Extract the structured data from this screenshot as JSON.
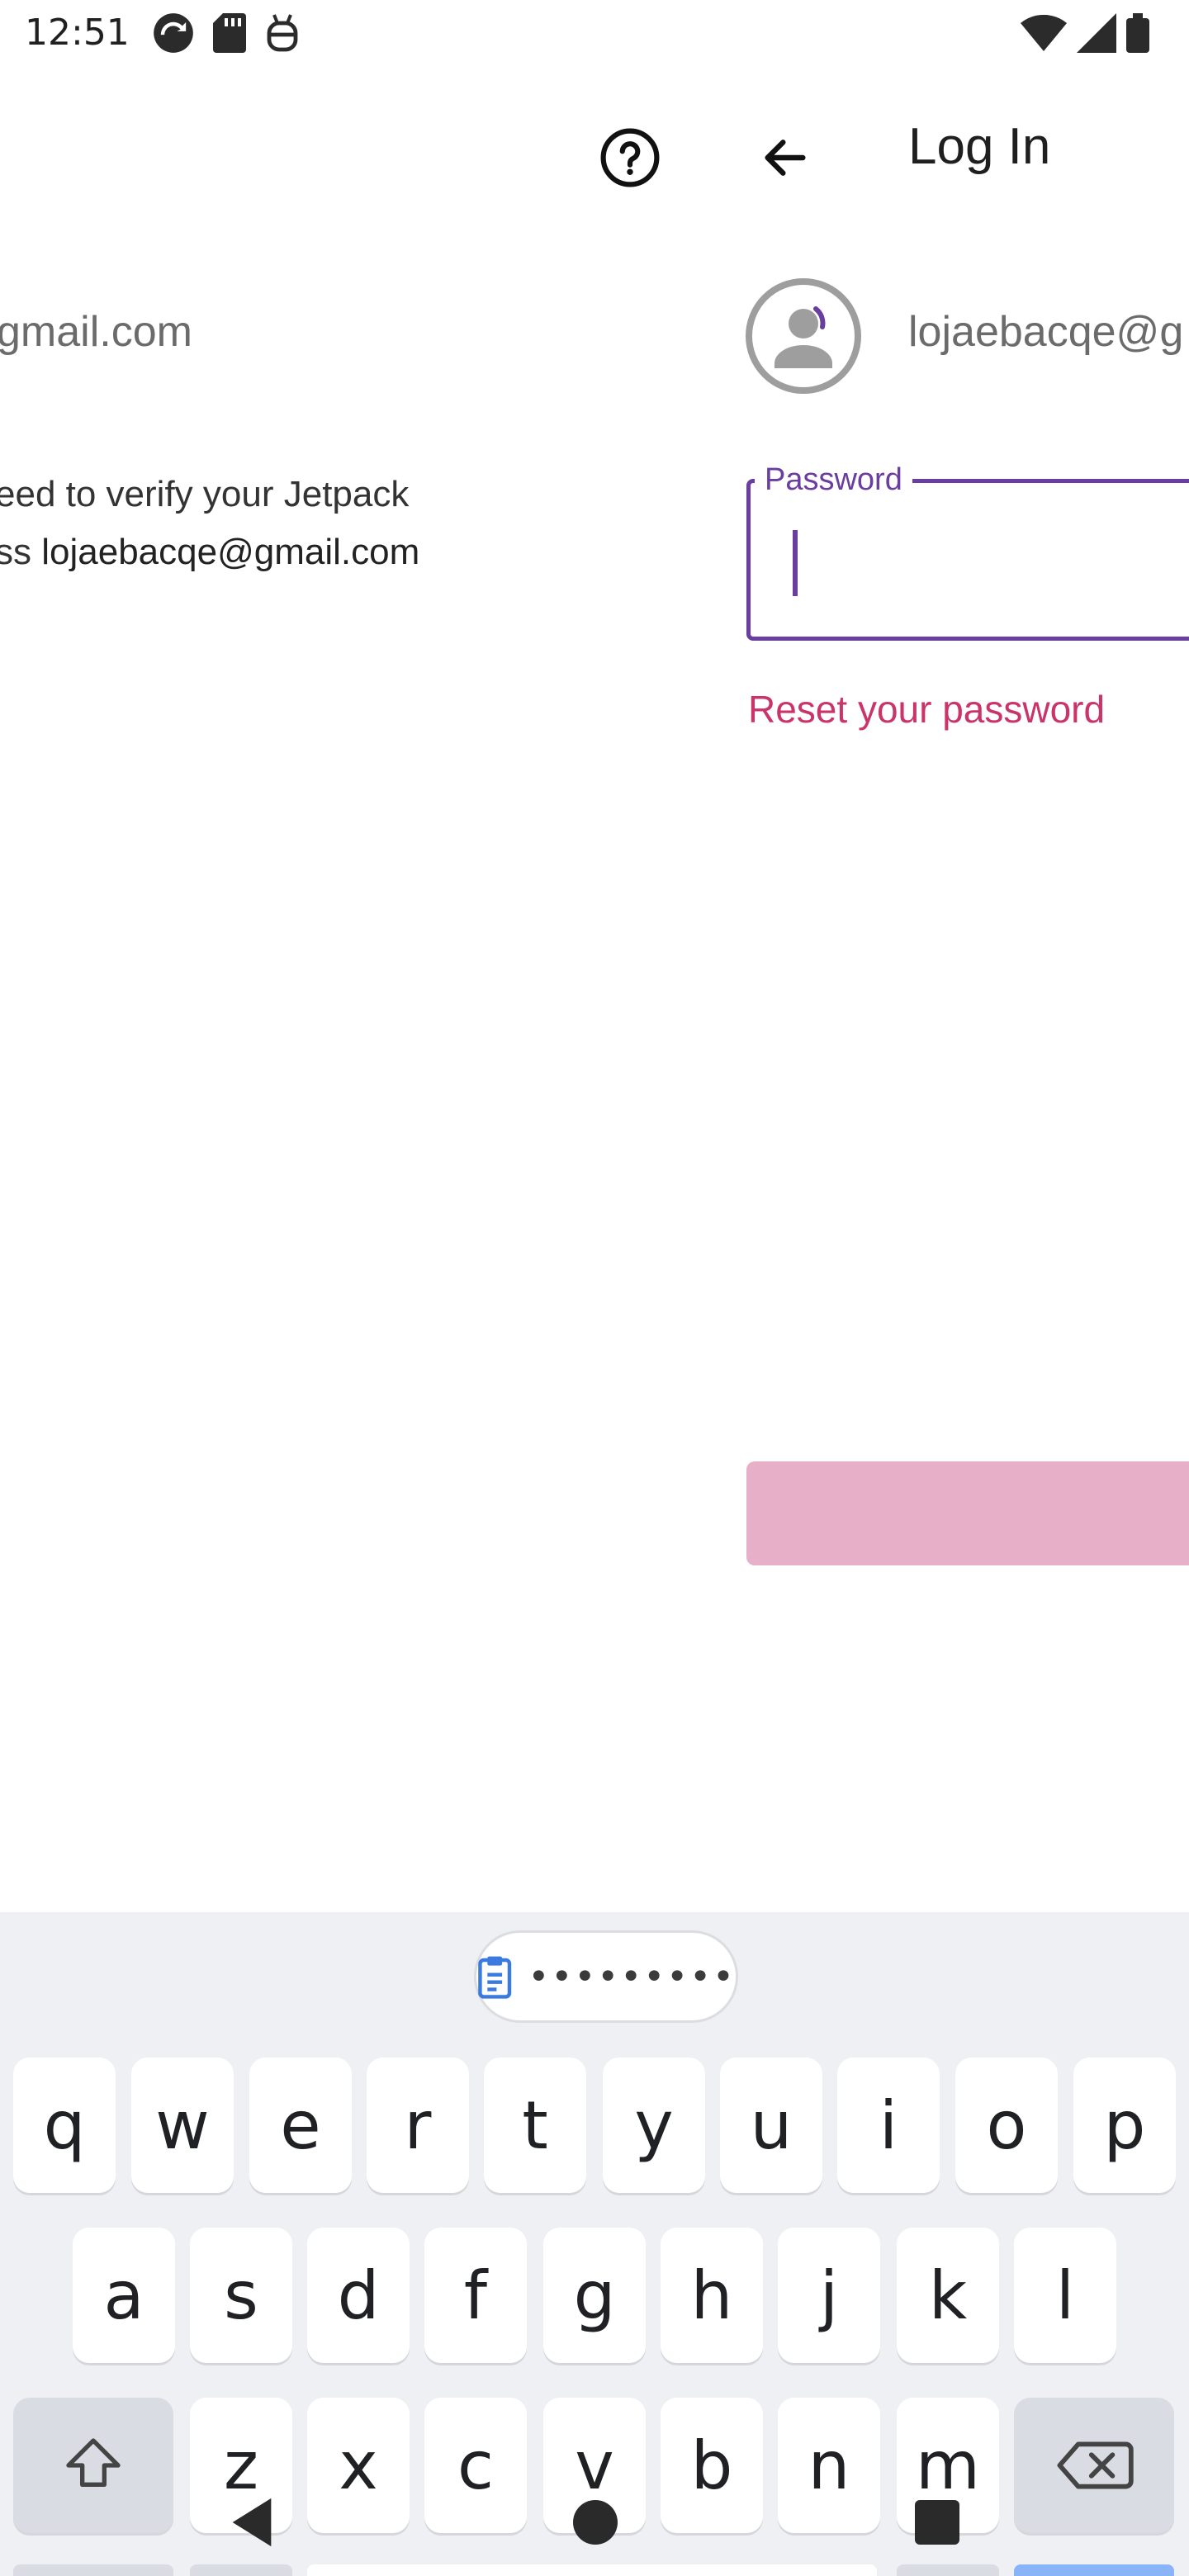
{
  "status_bar": {
    "time": "12:51",
    "left_icons": [
      "sync-icon",
      "sd-card-icon",
      "android-debug-icon"
    ],
    "right_icons": [
      "wifi-icon",
      "signal-icon",
      "battery-icon"
    ]
  },
  "left_panel": {
    "email": "gmail.com",
    "description_line1": "eed to verify your Jetpack",
    "description_line2_prefix": "ss ",
    "description_line2_email": "lojaebacqe@gmail.com",
    "help_icon": "help-circle-icon"
  },
  "right_panel": {
    "title": "Log In",
    "back_icon": "arrow-back-icon",
    "avatar_icon": "user-avatar-icon",
    "email": "lojaebacqe@g",
    "password_label": "Password",
    "reset_link": "Reset your password"
  },
  "keyboard": {
    "clipboard_icon": "clipboard-icon",
    "clipboard_preview": "•••••••••",
    "row1": [
      "q",
      "w",
      "e",
      "r",
      "t",
      "y",
      "u",
      "i",
      "o",
      "p"
    ],
    "row2": [
      "a",
      "s",
      "d",
      "f",
      "g",
      "h",
      "j",
      "k",
      "l"
    ],
    "row3": [
      "z",
      "x",
      "c",
      "v",
      "b",
      "n",
      "m"
    ],
    "shift_icon": "shift-icon",
    "backspace_icon": "backspace-icon"
  },
  "nav_bar": {
    "back_icon": "nav-back-icon",
    "home_icon": "nav-home-icon",
    "recents_icon": "nav-recents-icon"
  },
  "colors": {
    "accent": "#6a3ea1",
    "link": "#c9356b",
    "button_disabled": "#e8b0c8",
    "keyboard_bg": "#eef0f4"
  }
}
